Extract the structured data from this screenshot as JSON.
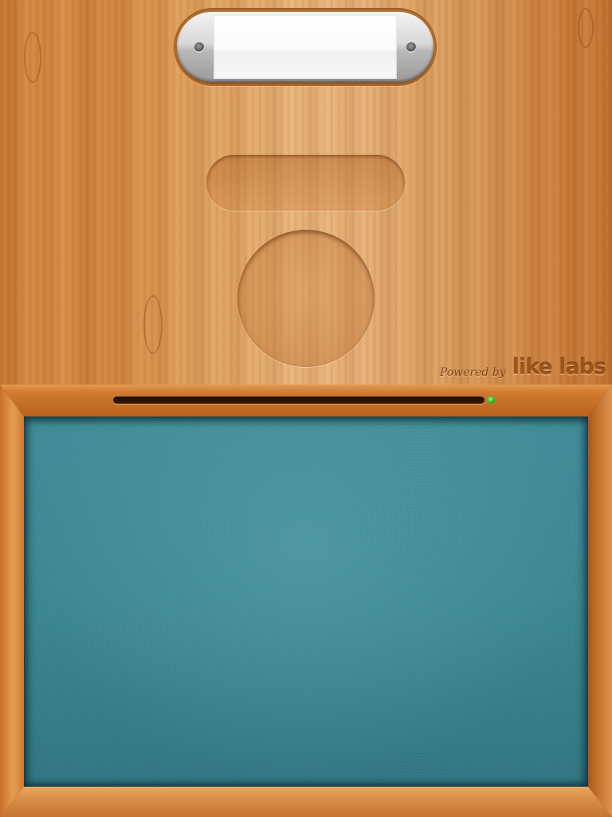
{
  "label_plate": {
    "text": ""
  },
  "branding": {
    "powered_by": "Powered by",
    "brand": "like labs"
  },
  "colors": {
    "wood_light": "#e8b47a",
    "wood_dark": "#c17130",
    "frame": "#cf7a30",
    "felt": "#3a8794",
    "slot": "#2a1204",
    "status_led": "#2fc52b"
  },
  "icons": {
    "status_indicator": "green-led-dot",
    "rivets": "metal-rivet"
  }
}
